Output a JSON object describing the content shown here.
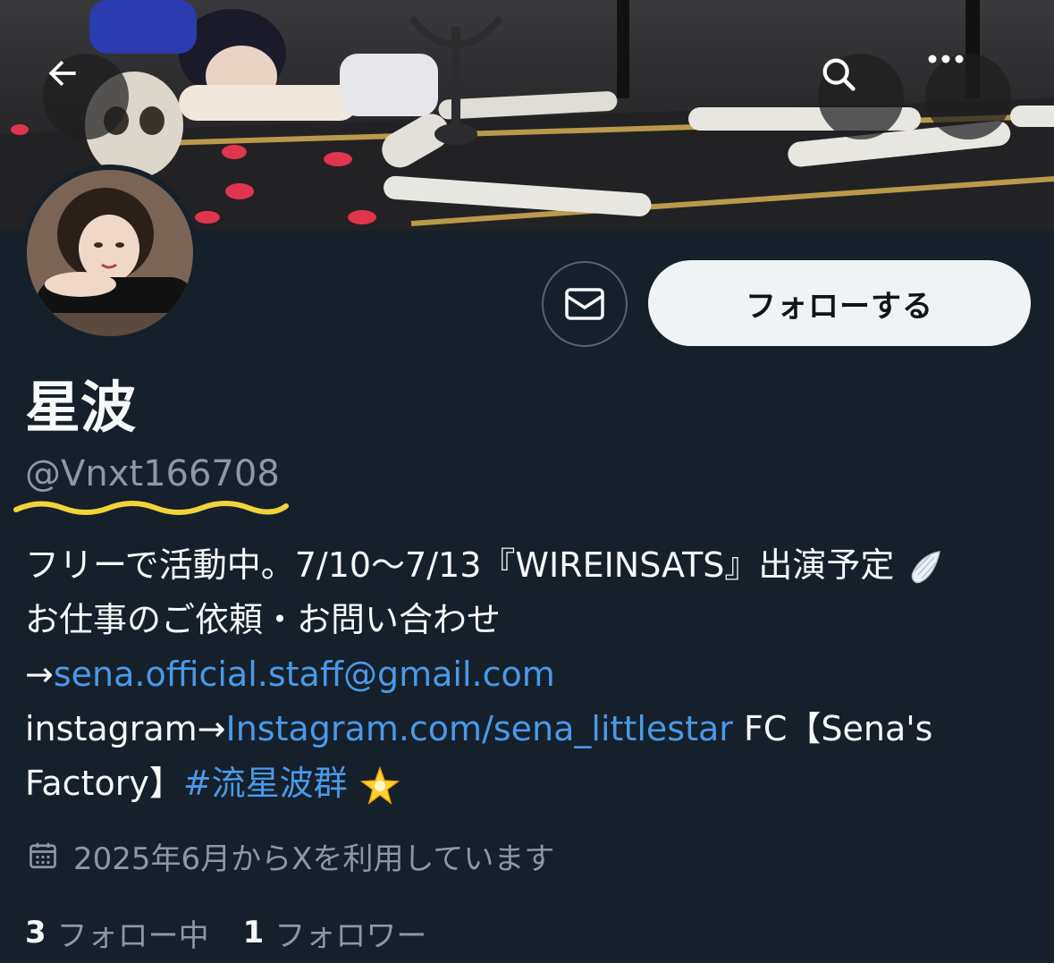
{
  "profile": {
    "display_name": "星波",
    "handle": "@Vnxt166708",
    "avatar_icon": "profile-photo"
  },
  "header": {
    "back_icon": "back-arrow-icon",
    "search_icon": "search-icon",
    "more_icon": "more-options-icon"
  },
  "actions": {
    "dm_icon": "envelope-icon",
    "follow_label": "フォローする"
  },
  "bio": {
    "line1_text": "フリーで活動中。7/10～7/13『WIREINSATS』出演予定",
    "line1_emoji": "wing-emoji",
    "line2_text": "お仕事のご依頼・お問い合わせ",
    "line3_prefix": "→",
    "line3_email": "sena.official.staff@gmail.com",
    "line4_prefix": "instagram→",
    "line4_link": "Instagram.com/sena_littlestar",
    "line4_suffix": " FC【Sena's",
    "line5_text": "Factory】",
    "line5_hashtag": "#流星波群",
    "line5_emoji": "glowing-star-emoji"
  },
  "joined": {
    "icon": "calendar-icon",
    "text": "2025年6月からXを利用しています"
  },
  "stats": {
    "following_count": "3",
    "following_label": "フォロー中",
    "followers_count": "1",
    "followers_label": "フォロワー"
  },
  "colors": {
    "background": "#15202b",
    "link": "#4a99e9",
    "secondary_text": "#8b98a5",
    "annotation_underline": "#f2d43a"
  }
}
